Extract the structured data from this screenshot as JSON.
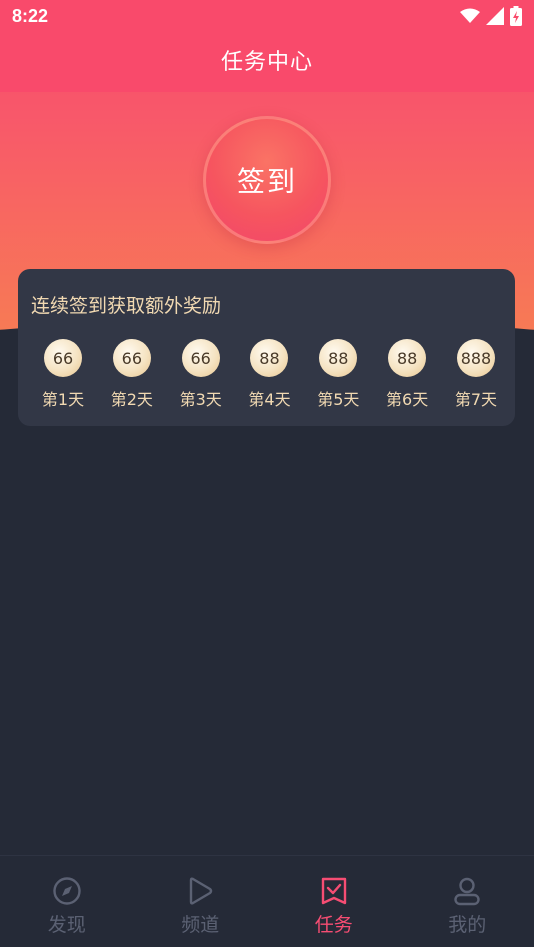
{
  "status_bar": {
    "time": "8:22",
    "icons": [
      "wifi-icon",
      "signal-icon",
      "battery-charging-icon"
    ]
  },
  "header": {
    "title": "任务中心"
  },
  "checkin": {
    "button_label": "签到"
  },
  "streak_card": {
    "title": "连续签到获取额外奖励",
    "days": [
      {
        "reward": "66",
        "label": "第1天"
      },
      {
        "reward": "66",
        "label": "第2天"
      },
      {
        "reward": "66",
        "label": "第3天"
      },
      {
        "reward": "88",
        "label": "第4天"
      },
      {
        "reward": "88",
        "label": "第5天"
      },
      {
        "reward": "88",
        "label": "第6天"
      },
      {
        "reward": "888",
        "label": "第7天"
      }
    ]
  },
  "tabbar": {
    "items": [
      {
        "label": "发现",
        "icon": "compass-icon",
        "active": false
      },
      {
        "label": "频道",
        "icon": "play-icon",
        "active": false
      },
      {
        "label": "任务",
        "icon": "task-check-icon",
        "active": true
      },
      {
        "label": "我的",
        "icon": "user-icon",
        "active": false
      }
    ]
  },
  "colors": {
    "header": "#f94a6b",
    "background": "#252a37",
    "card": "#323746",
    "gold_text": "#f1d9b2",
    "active_tab": "#f64d73",
    "inactive_tab": "#5b6173"
  }
}
